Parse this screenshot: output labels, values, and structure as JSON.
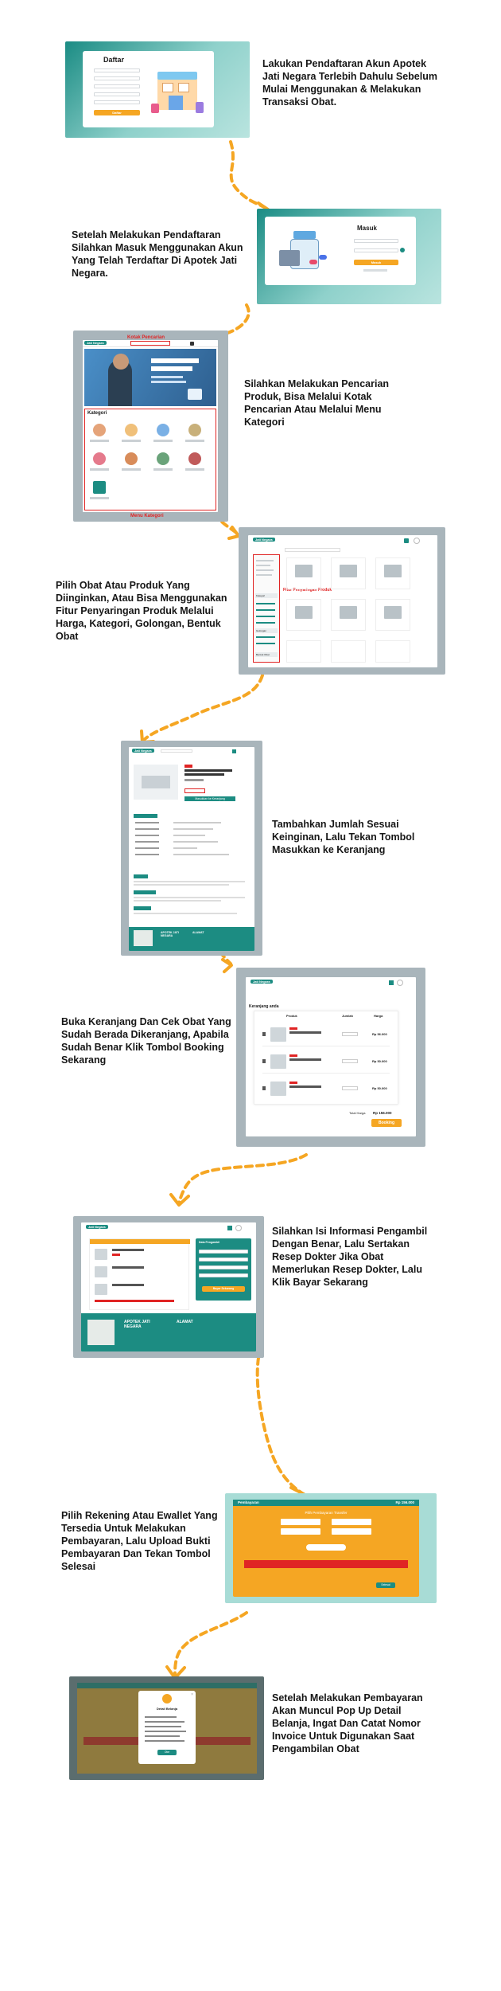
{
  "steps": [
    {
      "text": "Lakukan Pendaftaran Akun Apotek Jati Negara Terlebih Dahulu Sebelum Mulai Menggunakan & Melakukan Transaksi Obat."
    },
    {
      "text": "Setelah Melakukan Pendaftaran Silahkan Masuk Menggunakan Akun Yang Telah Terdaftar Di Apotek Jati Negara."
    },
    {
      "text": "Silahkan Melakukan Pencarian Produk, Bisa Melalui Kotak Pencarian Atau Melalui Menu Kategori"
    },
    {
      "text": "Pilih Obat Atau Produk Yang Diinginkan, Atau Bisa Menggunakan Fitur Penyaringan Produk Melalui Harga, Kategori, Golongan, Bentuk Obat"
    },
    {
      "text": "Tambahkan Jumlah Sesuai Keinginan, Lalu Tekan Tombol Masukkan ke Keranjang"
    },
    {
      "text": "Buka Keranjang Dan Cek Obat Yang Sudah Berada Dikeranjang, Apabila Sudah Benar Klik Tombol Booking Sekarang"
    },
    {
      "text": "Silahkan Isi Informasi Pengambil Dengan Benar, Lalu Sertakan Resep Dokter Jika Obat Memerlukan Resep Dokter, Lalu Klik Bayar Sekarang"
    },
    {
      "text": "Pilih Rekening Atau Ewallet Yang Tersedia Untuk Melakukan Pembayaran, Lalu Upload Bukti Pembayaran Dan Tekan Tombol Selesai"
    },
    {
      "text": "Setelah Melakukan Pembayaran Akan Muncul Pop Up Detail Belanja, Ingat Dan Catat Nomor Invoice Untuk Digunakan Saat Pengambilan Obat"
    }
  ],
  "register": {
    "title": "Daftar",
    "button": "Daftar"
  },
  "login": {
    "title": "Masuk",
    "button": "Masuk"
  },
  "home": {
    "brand": "Jati Negara",
    "search_label": "Kotak Pencarian",
    "menu_label": "Menu Kategori",
    "category_title": "Kategori",
    "category_items": [
      "Obat",
      "Vitamin",
      "Suplemen",
      "Herbal",
      "Alat Kesehatan",
      "Ibu & Anak",
      "Perawatan",
      "Kecantikan",
      "Lainnya"
    ]
  },
  "catalog": {
    "brand": "Jati Negara",
    "filter_label": "Fitur Penyaringan Produk",
    "filter_sections": [
      "Kategori",
      "Golongan",
      "Bentuk Obat"
    ]
  },
  "detail": {
    "brand": "Jati Negara",
    "add_button": "Masukkan ke Keranjang",
    "footer_title": "APOTEK JATI NEGARA",
    "footer_address": "ALAMAT"
  },
  "cart": {
    "brand": "Jati Negara",
    "title": "Keranjang anda",
    "col_product": "Produk",
    "col_qty": "Jumlah",
    "col_price": "Harga",
    "prices": [
      "Rp 56.000",
      "Rp 50.000",
      "Rp 50.000"
    ],
    "total_label": "Total Harga",
    "total_value": "Rp 156.000",
    "booking_button": "Booking"
  },
  "checkout": {
    "brand": "Jati Negara",
    "panel_title": "Data Pengambil",
    "pay_button": "Bayar Sekarang",
    "footer_title": "APOTEK JATI NEGARA",
    "footer_address": "ALAMAT"
  },
  "payment": {
    "title": "Pembayaran",
    "total": "Rp 156.000",
    "subtitle": "Pilih Pembayaran Transfer",
    "finish_button": "Selesai"
  },
  "popup": {
    "title": "Detail Belanja",
    "ok_button": "Oke"
  },
  "colors": {
    "teal": "#1c8c82",
    "orange": "#f5a623",
    "red": "#e02424",
    "arrow": "#f5a623"
  }
}
